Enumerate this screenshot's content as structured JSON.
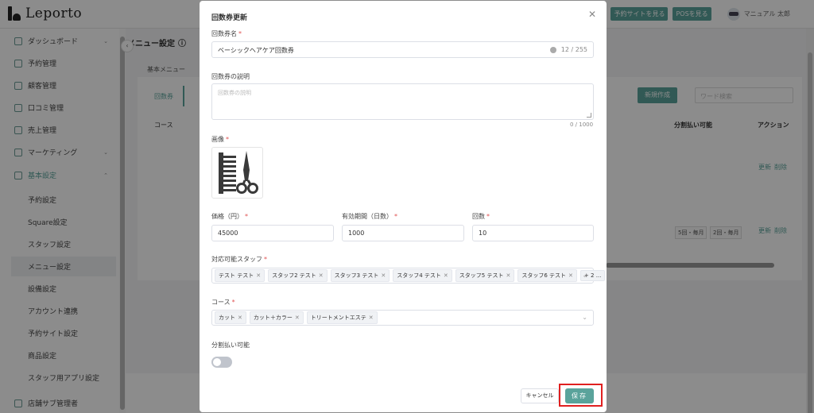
{
  "app": {
    "logo_text": "Leporto",
    "header_buttons": [
      "予約サイトを見る",
      "POSを見る"
    ],
    "user_name": "マニュアル 太郎"
  },
  "sidebar": {
    "items": [
      {
        "label": "ダッシュボード",
        "has_chevron": true
      },
      {
        "label": "予約管理",
        "has_chevron": false
      },
      {
        "label": "顧客管理",
        "has_chevron": false
      },
      {
        "label": "口コミ管理",
        "has_chevron": false
      },
      {
        "label": "売上管理",
        "has_chevron": false
      },
      {
        "label": "マーケティング",
        "has_chevron": true
      },
      {
        "label": "基本設定",
        "has_chevron": true
      }
    ],
    "sub_items": [
      "予約設定",
      "Square設定",
      "スタッフ設定",
      "メニュー設定",
      "設備設定",
      "アカウント連携",
      "予約サイト設定",
      "商品設定",
      "スタッフ用アプリ設定"
    ],
    "active_sub": "メニュー設定",
    "bottom_item": "店舗サブ管理者"
  },
  "page": {
    "title": "メニュー設定",
    "section": "基本メニュー",
    "tab_selected": "回数券",
    "row_label": "コース",
    "new_button": "新規作成",
    "search_placeholder": "ワード検索",
    "columns": [
      "分割払い可能",
      "アクション"
    ],
    "row_actions": [
      "更新",
      "削除"
    ],
    "row_tags": [
      "5回・毎月",
      "2回・毎月"
    ]
  },
  "modal": {
    "title": "回数券更新",
    "name_label": "回数券名",
    "name_value": "ベーシックヘアケア回数券",
    "name_counter": "12 / 255",
    "desc_label": "回数券の説明",
    "desc_placeholder": "回数券の説明",
    "desc_counter": "0 / 1000",
    "image_label": "画像",
    "price_label": "価格（円）",
    "price_value": "45000",
    "period_label": "有効期間（日数）",
    "period_value": "1000",
    "count_label": "回数",
    "count_value": "10",
    "staff_label": "対応可能スタッフ",
    "staff_tags": [
      "テスト テスト",
      "スタッフ2 テスト",
      "スタッフ3 テスト",
      "スタッフ4 テスト",
      "スタッフ5 テスト",
      "スタッフ6 テスト"
    ],
    "staff_more": "+ 2 ...",
    "course_label": "コース",
    "course_tags": [
      "カット",
      "カット＋カラー",
      "トリートメントエステ"
    ],
    "installment_label": "分割払い可能",
    "installment_enabled": false,
    "cancel_label": "キャンセル",
    "save_label": "保存"
  },
  "colors": {
    "accent": "#5aa39b",
    "required": "#e05252",
    "highlight": "#e02020"
  }
}
